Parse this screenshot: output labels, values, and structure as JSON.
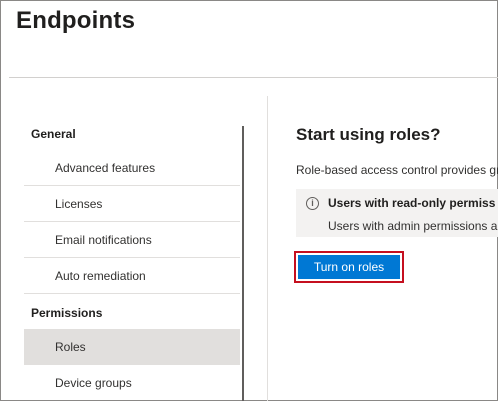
{
  "header": {
    "title": "Endpoints"
  },
  "nav": {
    "sections": [
      {
        "label": "General",
        "items": [
          "Advanced features",
          "Licenses",
          "Email notifications",
          "Auto remediation"
        ]
      },
      {
        "label": "Permissions",
        "items": [
          "Roles",
          "Device groups"
        ]
      }
    ],
    "selected": "Roles"
  },
  "content": {
    "title": "Start using roles?",
    "description": "Role-based access control provides gr",
    "info": {
      "icon": "info-icon",
      "title": "Users with read-only permiss",
      "text": "Users with admin permissions a"
    },
    "button_label": "Turn on roles"
  },
  "colors": {
    "accent": "#0078d4",
    "highlight": "#c50f1f",
    "selected_bg": "#e1dfdd"
  }
}
